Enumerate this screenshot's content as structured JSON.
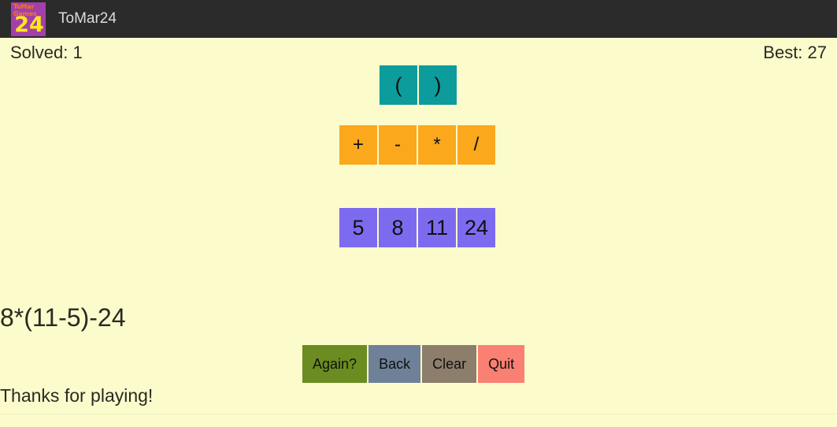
{
  "titlebar": {
    "app_icon": {
      "name": "tomar-games-24-icon",
      "brand_line1": "ToMar",
      "brand_line2": "Games",
      "number": "24",
      "bg_color": "#a43fa9",
      "brand_color": "#f07a1e",
      "number_color": "#ffe81c"
    },
    "title": "ToMar24",
    "bg_color": "#2b2b2b",
    "text_color": "#dcdcdc"
  },
  "status": {
    "solved_label": "Solved: 1",
    "best_label": "Best: 27"
  },
  "paren_buttons": [
    {
      "label": "(",
      "name": "open-paren-button"
    },
    {
      "label": ")",
      "name": "close-paren-button"
    }
  ],
  "operator_buttons": [
    {
      "label": "+",
      "name": "operator-plus-button"
    },
    {
      "label": "-",
      "name": "operator-minus-button"
    },
    {
      "label": "*",
      "name": "operator-multiply-button"
    },
    {
      "label": "/",
      "name": "operator-divide-button"
    }
  ],
  "number_buttons": [
    {
      "label": "5",
      "name": "number-button-5"
    },
    {
      "label": "8",
      "name": "number-button-8"
    },
    {
      "label": "11",
      "name": "number-button-11"
    },
    {
      "label": "24",
      "name": "number-button-24"
    }
  ],
  "expression": "8*(11-5)-24",
  "action_buttons": [
    {
      "label": "Again?",
      "color": "#6b8c20"
    },
    {
      "label": "Back",
      "color": "#6e8198"
    },
    {
      "label": "Clear",
      "color": "#8c7e6b"
    },
    {
      "label": "Quit",
      "color": "#f98072"
    }
  ],
  "footer_message": "Thanks for playing!",
  "colors": {
    "background": "#fbfbcc",
    "paren_button": "#0d9c9c",
    "operator_button": "#fba81c",
    "number_button": "#7d6bef",
    "text": "#2a2a22"
  }
}
